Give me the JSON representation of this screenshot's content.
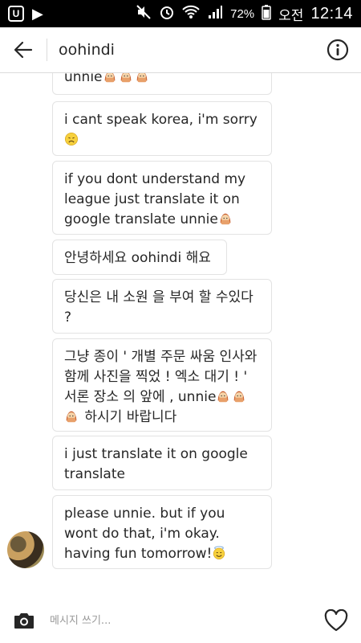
{
  "status_bar": {
    "battery": "72%",
    "ampm": "오전",
    "time": "12:14",
    "icons": [
      "carrier-icon",
      "play-icon",
      "mute-icon",
      "alarm-icon",
      "wifi-icon",
      "signal-icon",
      "battery-icon"
    ]
  },
  "header": {
    "title": "oohindi",
    "back_icon": "arrow-left-icon",
    "info_icon": "info-icon"
  },
  "messages": [
    {
      "segments": [
        {
          "t": "text",
          "v": "unnie"
        },
        {
          "t": "emoji",
          "v": "tongue-blush-emoji"
        },
        {
          "t": "emoji",
          "v": "tongue-blush-emoji"
        },
        {
          "t": "emoji",
          "v": "tongue-blush-emoji"
        }
      ]
    },
    {
      "segments": [
        {
          "t": "text",
          "v": "i cant speak korea, i'm sorry"
        },
        {
          "t": "emoji",
          "v": "worried-face-emoji"
        }
      ]
    },
    {
      "segments": [
        {
          "t": "text",
          "v": "if you dont understand my league just translate it on google translate unnie"
        },
        {
          "t": "emoji",
          "v": "tongue-blush-emoji"
        }
      ]
    },
    {
      "segments": [
        {
          "t": "text",
          "v": "안녕하세요 oohindi 해요"
        }
      ]
    },
    {
      "segments": [
        {
          "t": "text",
          "v": "당신은 내 소원 을 부여 할 수있다 ?"
        }
      ]
    },
    {
      "segments": [
        {
          "t": "text",
          "v": "그냥 종이 ' 개별 주문 싸움 인사와 함께 사진을 찍었 ! 엑소 대기 ! ' 서론 장소 의 앞에 , unnie"
        },
        {
          "t": "emoji",
          "v": "tongue-blush-emoji"
        },
        {
          "t": "emoji",
          "v": "tongue-blush-emoji"
        },
        {
          "t": "emoji",
          "v": "tongue-blush-emoji"
        },
        {
          "t": "text",
          "v": " 하시기 바랍니다"
        }
      ]
    },
    {
      "segments": [
        {
          "t": "text",
          "v": "i just translate it on google translate"
        }
      ]
    },
    {
      "segments": [
        {
          "t": "text",
          "v": "please unnie. but if you wont do that, i'm okay. having fun tomorrow!"
        },
        {
          "t": "emoji",
          "v": "smiling-halo-emoji"
        }
      ]
    }
  ],
  "composer": {
    "placeholder": "메시지 쓰기...",
    "camera_icon": "camera-icon",
    "heart_icon": "heart-icon"
  }
}
